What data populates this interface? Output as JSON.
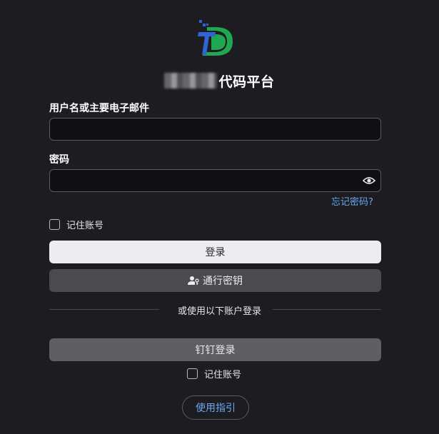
{
  "logo": {
    "icon": "td-logo-icon",
    "colors": {
      "blue": "#2f63d6",
      "green": "#1fa84f"
    }
  },
  "header": {
    "title": "代码平台",
    "blurred_prefix": "redacted-name"
  },
  "form": {
    "username_label": "用户名或主要电子邮件",
    "username_value": "",
    "password_label": "密码",
    "password_value": "",
    "password_toggle_icon": "eye-icon",
    "forgot_password": "忘记密码?",
    "remember_label": "记住账号",
    "remember_checked": false,
    "login_button": "登录",
    "passkey_button": "通行密钥",
    "passkey_icon": "user-key-icon"
  },
  "alt_login": {
    "divider_text": "或使用以下账户登录",
    "dingtalk_button": "钉钉登录",
    "remember_label": "记住账号",
    "remember_checked": false
  },
  "footer": {
    "guide_button": "使用指引"
  },
  "colors": {
    "background": "#1c1c21",
    "link": "#6aa8f2",
    "primary_button": "#ededf0"
  }
}
